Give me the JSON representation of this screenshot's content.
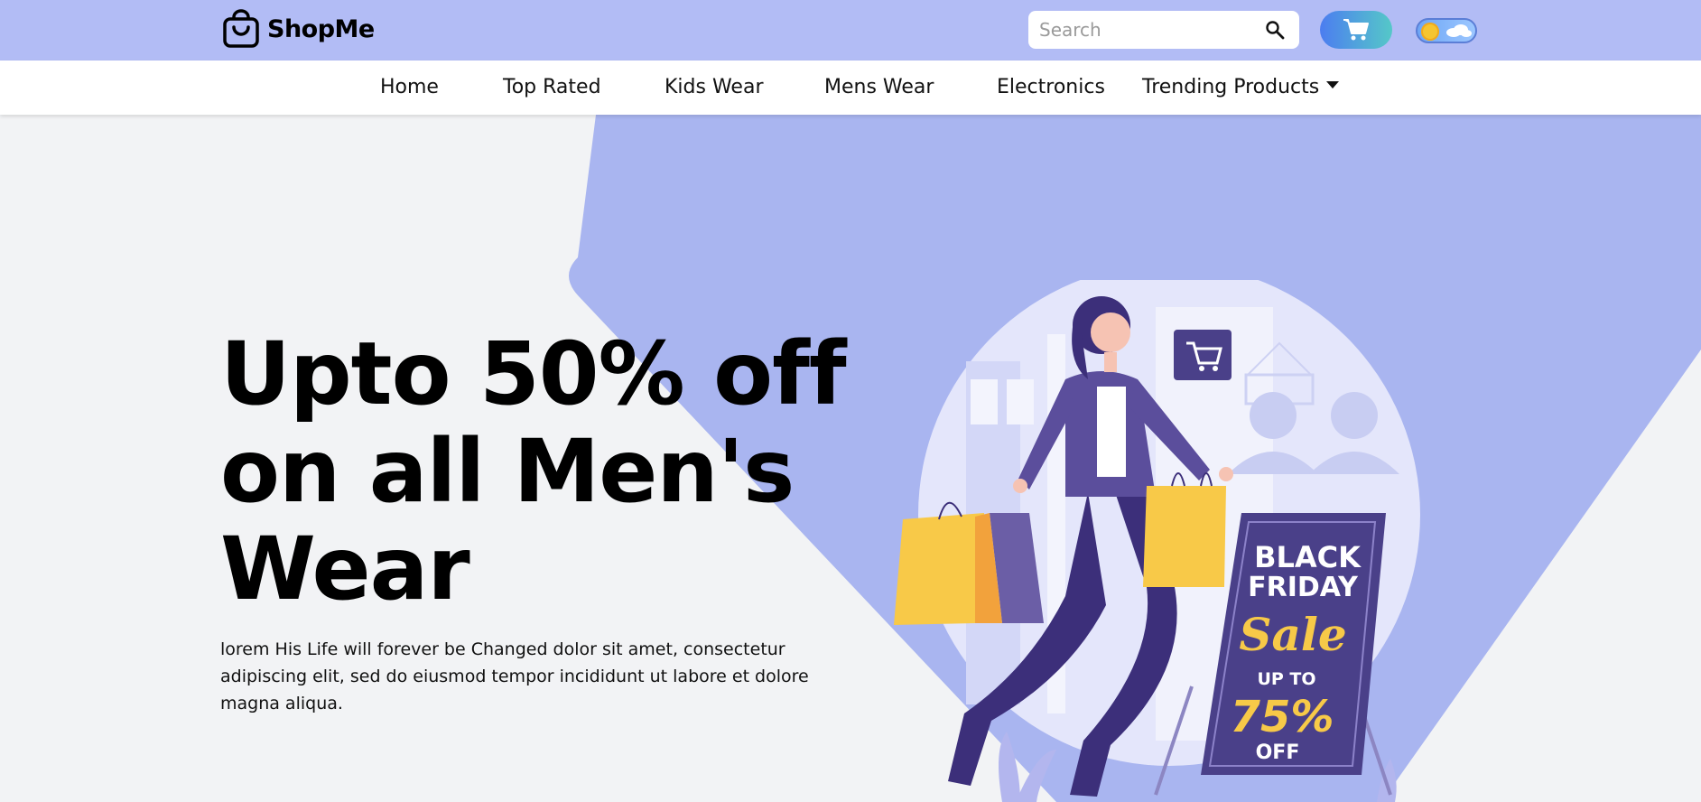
{
  "brand": {
    "name": "ShopMe",
    "icon": "shopping-bag-icon"
  },
  "search": {
    "placeholder": "Search",
    "value": "",
    "icon": "search-icon"
  },
  "cart": {
    "icon": "cart-icon"
  },
  "theme_toggle": {
    "state": "light",
    "icons": [
      "sun-icon",
      "cloud-icon"
    ]
  },
  "nav": {
    "items": [
      {
        "label": "Home"
      },
      {
        "label": "Top Rated"
      },
      {
        "label": "Kids Wear"
      },
      {
        "label": "Mens Wear"
      },
      {
        "label": "Electronics"
      },
      {
        "label": "Trending Products",
        "dropdown": true
      }
    ]
  },
  "hero": {
    "headline": "Upto 50% off on all Men's Wear",
    "description": "lorem His Life will forever be Changed dolor sit amet, consectetur adipiscing elit, sed do eiusmod tempor incididunt ut labore et dolore magna aliqua.",
    "sign": {
      "line1": "BLACK",
      "line2": "FRIDAY",
      "line3": "Sale",
      "line4": "UP TO",
      "line5": "75%",
      "line6": "OFF"
    }
  },
  "colors": {
    "topbar": "#b2bcf5",
    "accent_shape": "#a9b5f0",
    "page_bg": "#f2f3f5",
    "sign_bg": "#4a4089",
    "sign_yellow": "#f7c948"
  }
}
